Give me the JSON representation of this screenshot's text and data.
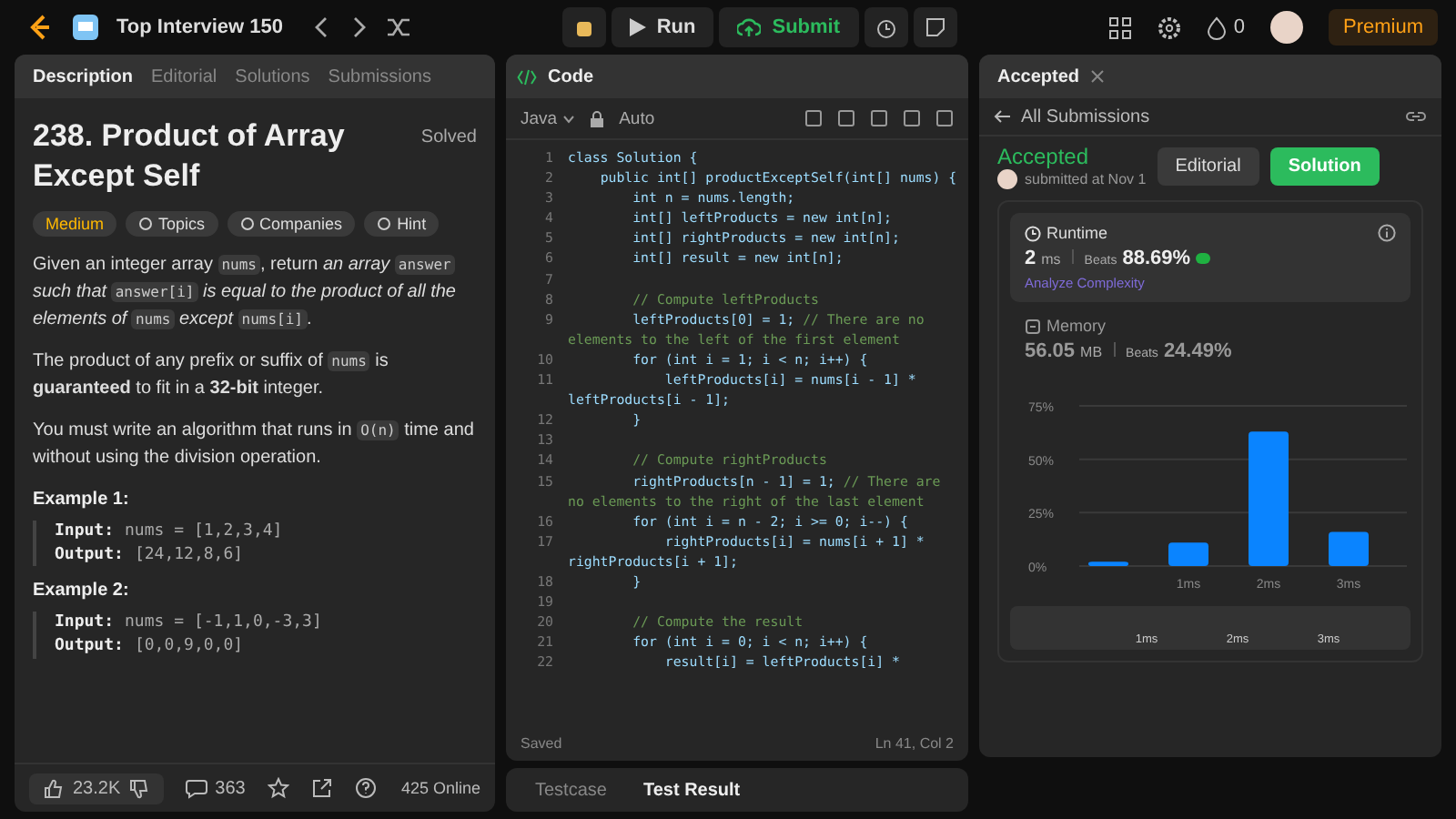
{
  "top_bar": {
    "list_title": "Top Interview 150",
    "run": "Run",
    "submit": "Submit",
    "streak": "0",
    "premium": "Premium"
  },
  "description_panel": {
    "tabs": [
      {
        "label": "Description",
        "selected": true
      },
      {
        "label": "Editorial",
        "selected": false
      },
      {
        "label": "Solutions",
        "selected": false
      },
      {
        "label": "Submissions",
        "selected": false
      }
    ],
    "title": "238. Product of Array Except Self",
    "status": "Solved",
    "tags": [
      {
        "kind": "difficulty",
        "label": "Medium"
      },
      {
        "kind": "topics",
        "label": "Topics"
      },
      {
        "kind": "companies",
        "label": "Companies"
      },
      {
        "kind": "hint",
        "label": "Hint"
      }
    ],
    "paragraphs": [
      [
        {
          "kind": "text",
          "text": "Given an integer array "
        },
        {
          "kind": "code",
          "text": "nums"
        },
        {
          "kind": "text",
          "text": ", return "
        },
        {
          "kind": "em",
          "text": "an array "
        },
        {
          "kind": "code",
          "text": "answer"
        },
        {
          "kind": "em",
          "text": " such that "
        },
        {
          "kind": "code",
          "text": "answer[i]"
        },
        {
          "kind": "em",
          "text": " is equal to the product of all the elements of "
        },
        {
          "kind": "code",
          "text": "nums"
        },
        {
          "kind": "em",
          "text": " except "
        },
        {
          "kind": "code",
          "text": "nums[i]"
        },
        {
          "kind": "text",
          "text": "."
        }
      ],
      [
        {
          "kind": "text",
          "text": "The product of any prefix or suffix of "
        },
        {
          "kind": "code",
          "text": "nums"
        },
        {
          "kind": "text",
          "text": " is "
        },
        {
          "kind": "strong",
          "text": "guaranteed"
        },
        {
          "kind": "text",
          "text": " to fit in a "
        },
        {
          "kind": "strong",
          "text": "32-bit"
        },
        {
          "kind": "text",
          "text": " integer."
        }
      ],
      [
        {
          "kind": "text",
          "text": "You must write an algorithm that runs in "
        },
        {
          "kind": "code",
          "text": "O(n)"
        },
        {
          "kind": "text",
          "text": " time and without using the division operation."
        }
      ]
    ],
    "examples": [
      {
        "heading": "Example 1:",
        "input_label": "Input:",
        "input": "nums = [1,2,3,4]",
        "output_label": "Output:",
        "output": "[24,12,8,6]"
      },
      {
        "heading": "Example 2:",
        "input_label": "Input:",
        "input": "nums = [-1,1,0,-3,3]",
        "output_label": "Output:",
        "output": "[0,0,9,0,0]"
      }
    ],
    "likes": "23.2K",
    "comments": "363",
    "online": "425 Online"
  },
  "code_panel": {
    "title": "Code",
    "language": "Java",
    "mode": "Auto",
    "lines": [
      {
        "number": "1",
        "code": "class Solution {"
      },
      {
        "number": "2",
        "code": "    public int[] productExceptSelf(int[] nums) {"
      },
      {
        "number": "3",
        "code": "        int n = nums.length;"
      },
      {
        "number": "4",
        "code": "        int[] leftProducts = new int[n];"
      },
      {
        "number": "5",
        "code": "        int[] rightProducts = new int[n];"
      },
      {
        "number": "6",
        "code": "        int[] result = new int[n];"
      },
      {
        "number": "7"
      },
      {
        "number": "8",
        "comment": "        // Compute leftProducts"
      },
      {
        "number": "9",
        "code": "        leftProducts[0] = 1; ",
        "comment": "// There are no elements to the left of the first element"
      },
      {
        "number": "10",
        "code": "        for (int i = 1; i < n; i++) {"
      },
      {
        "number": "11",
        "code": "            leftProducts[i] = nums[i - 1] * leftProducts[i - 1];"
      },
      {
        "number": "12",
        "code": "        }"
      },
      {
        "number": "13"
      },
      {
        "number": "14",
        "comment": "        // Compute rightProducts"
      },
      {
        "number": "15",
        "code": "        rightProducts[n - 1] = 1; ",
        "comment": "// There are no elements to the right of the last element"
      },
      {
        "number": "16",
        "code": "        for (int i = n - 2; i >= 0; i--) {"
      },
      {
        "number": "17",
        "code": "            rightProducts[i] = nums[i + 1] * rightProducts[i + 1];"
      },
      {
        "number": "18",
        "code": "        }"
      },
      {
        "number": "19"
      },
      {
        "number": "20",
        "comment": "        // Compute the result"
      },
      {
        "number": "21",
        "code": "        for (int i = 0; i < n; i++) {"
      },
      {
        "number": "22",
        "code": "            result[i] = leftProducts[i] *"
      }
    ],
    "status": "Saved",
    "cursor": "Ln 41, Col 2"
  },
  "console_tabs": [
    {
      "label": "Testcase",
      "selected": false
    },
    {
      "label": "Test Result",
      "selected": true
    }
  ],
  "result_panel": {
    "tab": "Accepted",
    "back": "All Submissions",
    "verdict": "Accepted",
    "submitted": "submitted at Nov 1",
    "editorial": "Editorial",
    "solution": "Solution",
    "runtime": {
      "label": "Runtime",
      "value": "2",
      "unit": "ms",
      "beats_label": "Beats",
      "beats": "88.69%",
      "analyze": "Analyze Complexity"
    },
    "memory": {
      "label": "Memory",
      "value": "56.05",
      "unit": "MB",
      "beats_label": "Beats",
      "beats": "24.49%"
    },
    "chart_data": {
      "type": "bar",
      "categories": [
        null,
        "1ms",
        "2ms",
        "3ms"
      ],
      "values": [
        2,
        11,
        63,
        16
      ],
      "ylim": [
        0,
        75
      ],
      "yticks": [
        {
          "value": 0,
          "label": "0%"
        },
        {
          "value": 25,
          "label": "25%"
        },
        {
          "value": 50,
          "label": "50%"
        },
        {
          "value": 75,
          "label": "75%"
        }
      ]
    },
    "range_labels": [
      "1ms",
      "2ms",
      "3ms"
    ]
  }
}
